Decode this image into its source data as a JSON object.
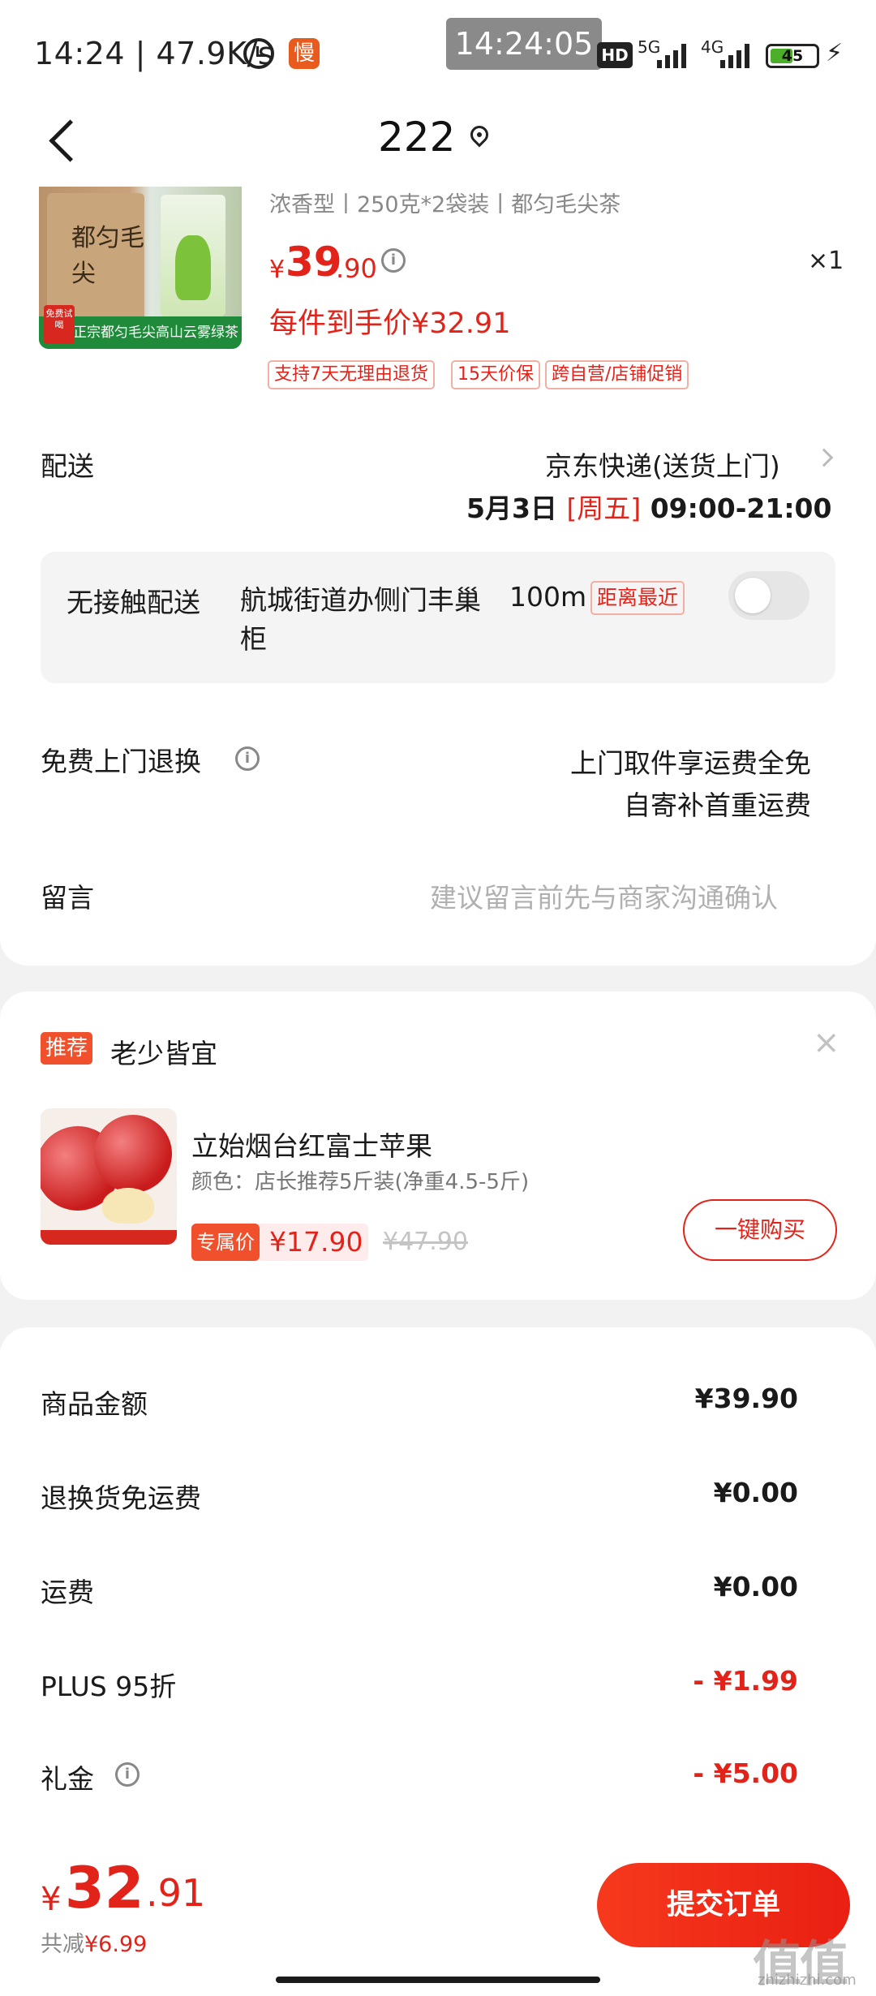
{
  "status_bar": {
    "time": "14:24 | 47.9K/s",
    "slow_badge": "慢",
    "clock_overlay": "14:24:05",
    "hd": "HD",
    "net1": "5G",
    "net2": "4G",
    "battery": "45"
  },
  "header": {
    "title": "222"
  },
  "product": {
    "image_banner": "正宗都匀毛尖高山云雾绿茶",
    "image_tag": "免费试喝",
    "image_bag_text": "都匀毛尖",
    "spec": "浓香型丨250克*2袋装丨都匀毛尖茶",
    "price_symbol": "¥",
    "price_int": "39",
    "price_dec": ".90",
    "quantity": "×1",
    "final_price": "每件到手价¥32.91",
    "tags": [
      "支持7天无理由退货",
      "15天价保",
      "跨自营/店铺促销"
    ]
  },
  "delivery": {
    "label": "配送",
    "method": "京东快递(送货上门)",
    "date": "5月3日",
    "weekday": "[周五]",
    "time_range": "09:00-21:00"
  },
  "contactless": {
    "title": "无接触配送",
    "location": "航城街道办侧门丰巢柜",
    "distance": "100m",
    "near_tag": "距离最近"
  },
  "returns": {
    "label": "免费上门退换",
    "line1": "上门取件享运费全免",
    "line2": "自寄补首重运费"
  },
  "message": {
    "label": "留言",
    "placeholder": "建议留言前先与商家沟通确认"
  },
  "recommend": {
    "badge": "推荐",
    "title": "老少皆宜",
    "close": "×",
    "name": "立始烟台红富士苹果",
    "spec": "颜色：店长推荐5斤装(净重4.5-5斤)",
    "excl_badge": "专属价",
    "excl_price": "¥17.90",
    "orig_price": "¥47.90",
    "buy_label": "一键购买"
  },
  "summary": [
    {
      "label": "商品金额",
      "value": "¥39.90",
      "red": false,
      "info": false
    },
    {
      "label": "退换货免运费",
      "value": "¥0.00",
      "red": false,
      "info": false
    },
    {
      "label": "运费",
      "value": "¥0.00",
      "red": false,
      "info": false
    },
    {
      "label": "PLUS 95折",
      "value": "- ¥1.99",
      "red": true,
      "info": false
    },
    {
      "label": "礼金",
      "value": "- ¥5.00",
      "red": true,
      "info": true
    }
  ],
  "footer": {
    "total_symbol": "¥",
    "total_int": "32",
    "total_dec": ".91",
    "saved_label": "共减",
    "saved_value": "¥6.99",
    "submit_label": "提交订单",
    "watermark": "值值值",
    "watermark_sub": "zhizhizhi.com"
  },
  "colors": {
    "accent": "#e2231a",
    "tag_border": "#f2b0a5"
  }
}
